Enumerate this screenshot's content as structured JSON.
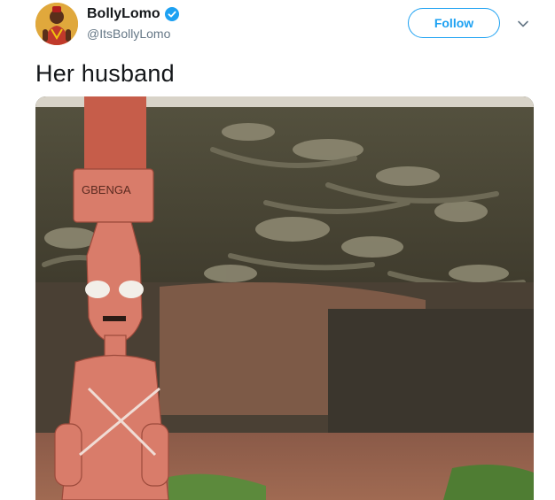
{
  "user": {
    "display_name": "BollyLomo",
    "handle": "@ItsBollyLomo",
    "verified": true
  },
  "actions": {
    "follow_label": "Follow"
  },
  "tweet": {
    "text": "Her husband"
  },
  "media": {
    "statue_inscription": "GBENGA"
  },
  "colors": {
    "accent": "#1da1f2",
    "handle": "#657786",
    "text": "#14171a"
  },
  "icons": [
    "verified-badge-icon",
    "chevron-down-icon"
  ]
}
